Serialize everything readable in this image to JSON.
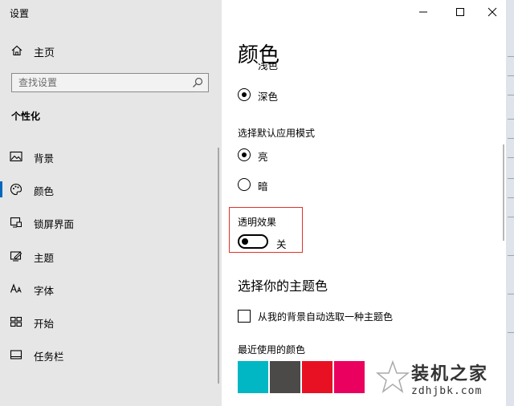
{
  "window": {
    "title": "设置",
    "minimize_icon": "minimize-icon",
    "maximize_icon": "maximize-icon",
    "close_icon": "close-icon"
  },
  "sidebar": {
    "home_label": "主页",
    "search_placeholder": "查找设置",
    "section_title": "个性化",
    "items": [
      {
        "label": "背景",
        "icon": "picture-icon"
      },
      {
        "label": "颜色",
        "icon": "palette-icon",
        "active": true
      },
      {
        "label": "锁屏界面",
        "icon": "lock-screen-icon"
      },
      {
        "label": "主题",
        "icon": "theme-icon"
      },
      {
        "label": "字体",
        "icon": "font-icon"
      },
      {
        "label": "开始",
        "icon": "start-icon"
      },
      {
        "label": "任务栏",
        "icon": "taskbar-icon"
      }
    ]
  },
  "main": {
    "title": "颜色",
    "partial_option": "浅色",
    "dark_option": "深色",
    "app_mode_label": "选择默认应用模式",
    "app_mode_light": "亮",
    "app_mode_dark": "暗",
    "transparency_label": "透明效果",
    "transparency_state": "关",
    "accent_heading": "选择你的主题色",
    "auto_accent_label": "从我的背景自动选取一种主题色",
    "recent_colors_label": "最近使用的颜色",
    "recent_colors": [
      "#00b7c3",
      "#4c4a48",
      "#e81123",
      "#ea005e"
    ]
  },
  "colors": {
    "accent": "#0067c0",
    "highlight_border": "#e0322c",
    "sidebar_bg": "#e6e6e6"
  },
  "watermark": {
    "title": "装机之家",
    "url": "zdhjbk.com"
  }
}
